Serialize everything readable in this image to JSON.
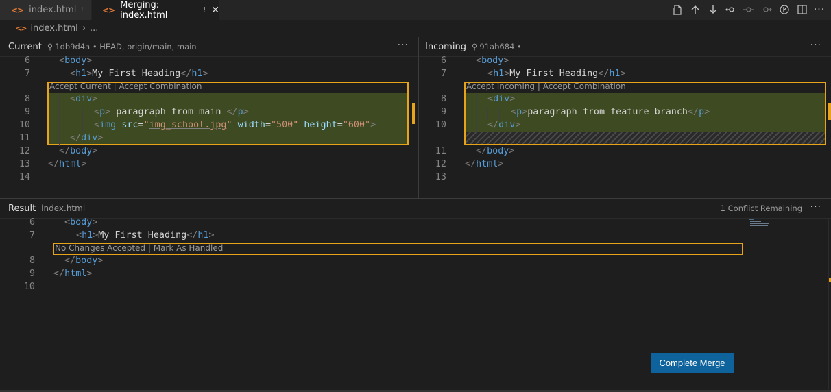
{
  "tabs": [
    {
      "label": "index.html",
      "dirty": "!",
      "icon": "<>"
    },
    {
      "label": "Merging: index.html",
      "dirty": "!",
      "icon": "<>",
      "close": "✕"
    }
  ],
  "breadcrumb": {
    "file": "index.html",
    "sep": "›",
    "more": "..."
  },
  "current": {
    "title": "Current",
    "meta": "1db9d4a • HEAD, origin/main, main",
    "dots": "···",
    "lens": "Accept Current | Accept Combination",
    "line_numbers": [
      "6",
      "7",
      "8",
      "9",
      "10",
      "11",
      "12",
      "13",
      "14"
    ]
  },
  "incoming": {
    "title": "Incoming",
    "meta": "91ab684 •",
    "dots": "···",
    "lens": "Accept Incoming | Accept Combination",
    "line_numbers": [
      "6",
      "7",
      "8",
      "9",
      "10",
      "11",
      "12",
      "13"
    ]
  },
  "result": {
    "title": "Result",
    "file": "index.html",
    "status": "1 Conflict Remaining",
    "dots": "···",
    "lens": "No Changes Accepted | Mark As Handled",
    "line_numbers": [
      "6",
      "7",
      "8",
      "9",
      "10"
    ]
  },
  "code": {
    "body": "body",
    "h1": "h1",
    "heading": "My First Heading",
    "div": "div",
    "p": "p",
    "main_text": " paragraph from main ",
    "feature_text": "paragraph from feature branch",
    "img": "img",
    "src_attr": "src",
    "src_val": "img_school.jpg",
    "width_attr": "width",
    "width_val": "\"500\"",
    "height_attr": "height",
    "height_val": "\"600\"",
    "html": "html"
  },
  "button": {
    "complete_merge": "Complete Merge"
  },
  "colors": {
    "accent": "#0e639c",
    "conflict": "#e7a41b",
    "highlight": "#3e4a21"
  }
}
